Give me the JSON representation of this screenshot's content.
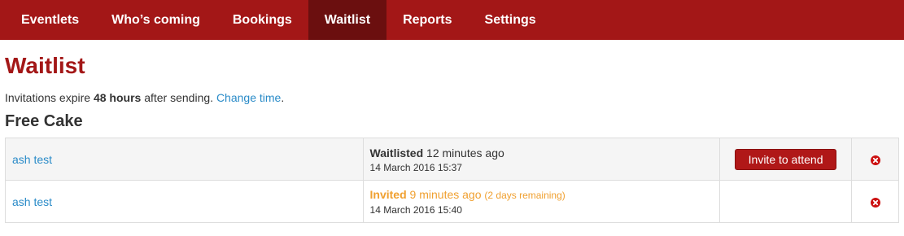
{
  "nav": {
    "items": [
      {
        "label": "Eventlets",
        "active": false
      },
      {
        "label": "Who’s coming",
        "active": false
      },
      {
        "label": "Bookings",
        "active": false
      },
      {
        "label": "Waitlist",
        "active": true
      },
      {
        "label": "Reports",
        "active": false
      },
      {
        "label": "Settings",
        "active": false
      }
    ]
  },
  "page": {
    "title": "Waitlist",
    "info_prefix": "Invitations expire ",
    "info_bold": "48 hours",
    "info_suffix": " after sending. ",
    "info_link": "Change time",
    "info_end": "."
  },
  "event": {
    "title": "Free Cake",
    "rows": [
      {
        "name": "ash test",
        "status_label": "Waitlisted",
        "status_time": " 12 minutes ago",
        "status_extra": "",
        "date": "14 March 2016 15:37",
        "action_label": "Invite to attend"
      },
      {
        "name": "ash test",
        "status_label": "Invited",
        "status_time": " 9 minutes ago",
        "status_extra": "(2 days remaining)",
        "date": "14 March 2016 15:40",
        "action_label": ""
      }
    ]
  },
  "colors": {
    "brand": "#a31717",
    "brand_dark": "#6b0f0f",
    "link": "#2a8bc8",
    "invited": "#f0a030",
    "remove": "#cc1111"
  },
  "icons": {
    "remove": "remove-circle-icon"
  }
}
